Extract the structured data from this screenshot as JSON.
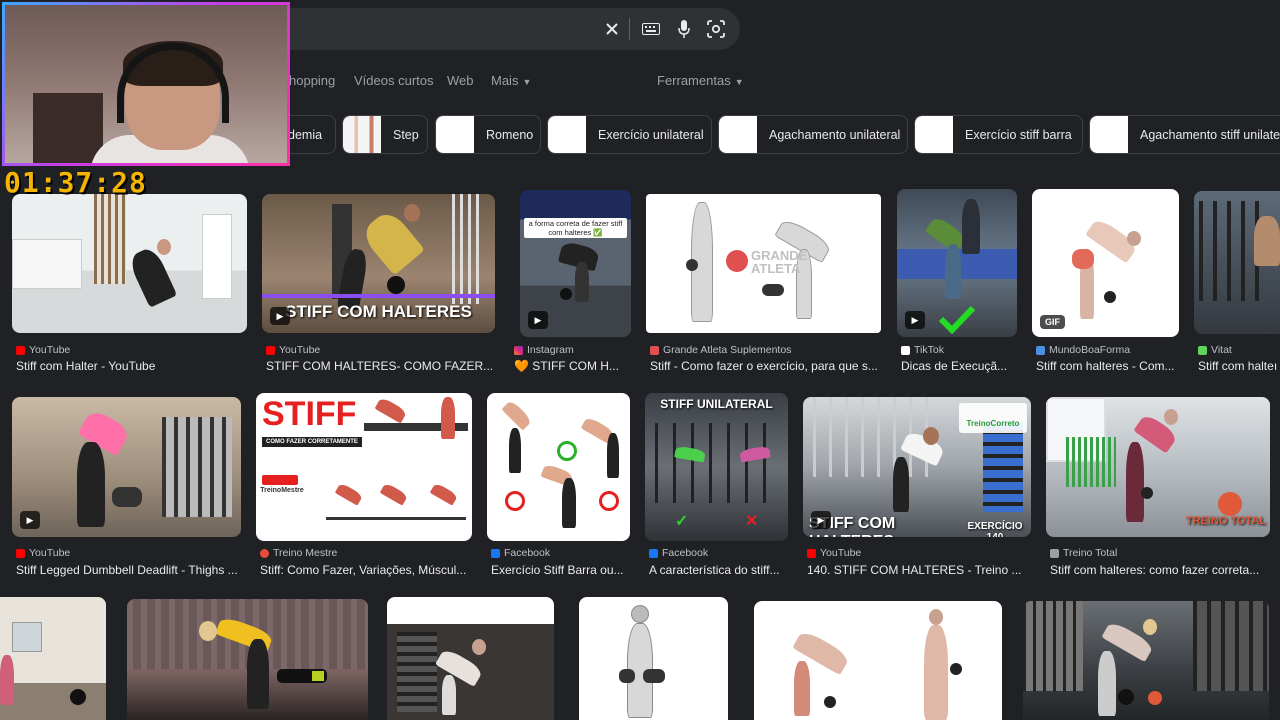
{
  "search": {
    "clear_icon": "close-icon",
    "keyboard_icon": "keyboard-icon",
    "mic_icon": "mic-icon",
    "lens_icon": "lens-icon"
  },
  "nav": {
    "tabs": [
      "hopping",
      "Vídeos curtos",
      "Web",
      "Mais"
    ],
    "tools": "Ferramentas"
  },
  "chips": [
    "demia",
    "Step",
    "Romeno",
    "Exercício unilateral",
    "Agachamento unilateral",
    "Exercício stiff barra",
    "Agachamento stiff unilater"
  ],
  "timer": "01:37:28",
  "results": [
    {
      "source": "YouTube",
      "title": "Stiff com Halter - YouTube",
      "overlay": "",
      "badge": "",
      "color": "#ff0000"
    },
    {
      "source": "YouTube",
      "title": "STIFF COM HALTERES- COMO FAZER...",
      "overlay": "STIFF COM HALTERES",
      "badge": "play",
      "color": "#ff0000"
    },
    {
      "source": "Instagram",
      "title": "🧡 STIFF COM H...",
      "overlay": "a forma correta de fazer stiff com halteres ✅",
      "badge": "play",
      "color": "#e1306c"
    },
    {
      "source": "Grande Atleta Suplementos",
      "title": "Stiff - Como fazer o exercício, para que s...",
      "overlay": "GRANDE ATLETA",
      "badge": "",
      "color": "#e05050"
    },
    {
      "source": "TikTok",
      "title": "Dicas de Execuçã...",
      "overlay": "",
      "badge": "play",
      "color": "#ffffff"
    },
    {
      "source": "MundoBoaForma",
      "title": "Stiff com halteres - Com...",
      "overlay": "",
      "badge": "GIF",
      "color": "#4a90e2"
    },
    {
      "source": "Vitat",
      "title": "Stiff com halteı",
      "overlay": "",
      "badge": "",
      "color": "#5cd65c"
    },
    {
      "source": "YouTube",
      "title": "Stiff Legged Dumbbell Deadlift - Thighs ...",
      "overlay": "",
      "badge": "play",
      "color": "#ff0000"
    },
    {
      "source": "Treino Mestre",
      "title": "Stiff: Como Fazer, Variações, Múscul...",
      "overlay": "STIFF",
      "badge": "",
      "color": "#e74c3c"
    },
    {
      "source": "Facebook",
      "title": "Exercício Stiff Barra ou...",
      "overlay": "",
      "badge": "",
      "color": "#1877f2"
    },
    {
      "source": "Facebook",
      "title": "A característica do stiff...",
      "overlay": "STIFF UNILATERAL",
      "badge": "",
      "color": "#1877f2"
    },
    {
      "source": "YouTube",
      "title": "140. STIFF COM HALTERES - Treino ...",
      "overlay": "STIFF COM HALTERES",
      "badge": "play",
      "color": "#ff0000"
    },
    {
      "source": "Treino Total",
      "title": "Stiff com halteres: como fazer correta...",
      "overlay": "TREINO TOTAL",
      "badge": "",
      "color": "#9aa0a6"
    }
  ],
  "overlay_extra": {
    "treino_correto": "TreinoCorreto",
    "exercicio": "EXERCÍCIO 140",
    "treino_mestre": "TreinoMestre",
    "como_fazer": "COMO FAZER CORRETAMENTE"
  }
}
